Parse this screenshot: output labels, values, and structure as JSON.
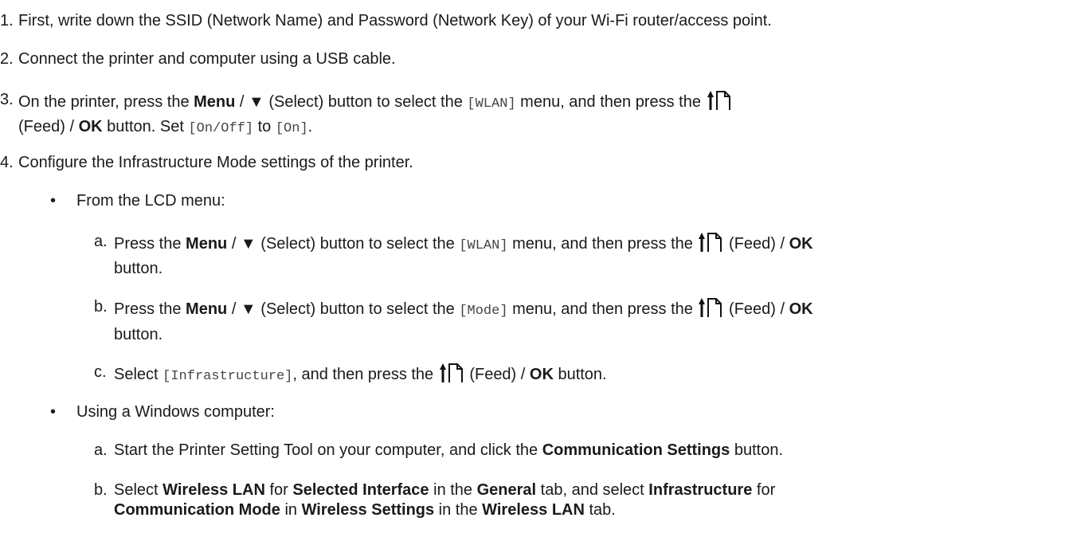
{
  "steps": {
    "s1": {
      "num": "1.",
      "text": "First, write down the SSID (Network Name) and Password (Network Key) of your Wi-Fi router/access point."
    },
    "s2": {
      "num": "2.",
      "text": "Connect the printer and computer using a USB cable."
    },
    "s3": {
      "num": "3.",
      "l1_a": "On the printer, press the ",
      "l1_menu": "Menu",
      "l1_b": " / ▼ (Select) button to select the ",
      "l1_code": "[WLAN]",
      "l1_c": " menu, and then press the",
      "l2_a": "(Feed) / ",
      "l2_ok": "OK",
      "l2_b": " button. Set ",
      "l2_code1": "[On/Off]",
      "l2_c": " to ",
      "l2_code2": "[On]",
      "l2_d": "."
    },
    "s4": {
      "num": "4.",
      "text": "Configure the Infrastructure Mode settings of the printer.",
      "bullet1": {
        "mark": "•",
        "text": "From the LCD menu:",
        "a": {
          "letter": "a.",
          "t1": "Press the ",
          "menu": "Menu",
          "t2": " / ▼ (Select) button to select the ",
          "code": "[WLAN]",
          "t3": " menu, and then press the",
          "t4": "(Feed) / ",
          "ok": "OK",
          "cont": "button."
        },
        "b": {
          "letter": "b.",
          "t1": "Press the ",
          "menu": "Menu",
          "t2": " / ▼ (Select) button to select the ",
          "code": "[Mode]",
          "t3": " menu, and then press the",
          "t4": "(Feed) / ",
          "ok": "OK",
          "cont": "button."
        },
        "c": {
          "letter": "c.",
          "t1": "Select ",
          "code": "[Infrastructure]",
          "t2": ", and then press the",
          "t3": "(Feed) / ",
          "ok": "OK",
          "t4": " button."
        }
      },
      "bullet2": {
        "mark": "•",
        "text": "Using a Windows computer:",
        "a": {
          "letter": "a.",
          "t1": "Start the Printer Setting Tool on your computer, and click the ",
          "b1": "Communication Settings",
          "t2": " button."
        },
        "b": {
          "letter": "b.",
          "t1": "Select ",
          "b1": "Wireless LAN",
          "t2": " for ",
          "b2": "Selected Interface",
          "t3": " in the ",
          "b3": "General",
          "t4": " tab, and select ",
          "b4": "Infrastructure",
          "t5": " for",
          "b5": "Communication Mode",
          "t6": " in ",
          "b6": "Wireless Settings",
          "t7": " in the ",
          "b7": "Wireless LAN",
          "t8": " tab."
        }
      }
    }
  },
  "icons": {
    "feed": "feed-arrow-paper-icon"
  }
}
